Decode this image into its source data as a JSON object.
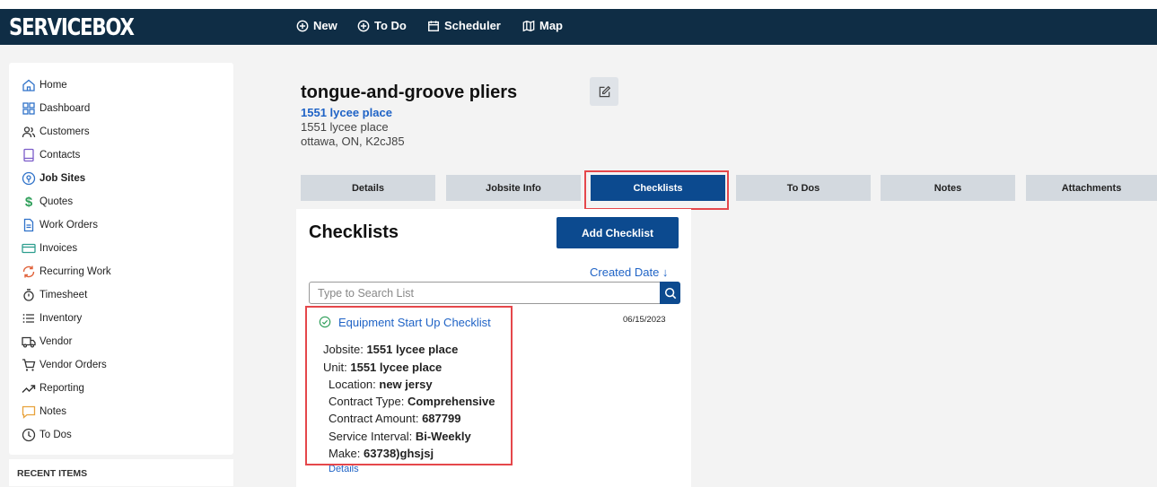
{
  "brand": "SERVICEBOX",
  "topnav": [
    {
      "label": "New",
      "icon": "plus-circle-icon"
    },
    {
      "label": "To Do",
      "icon": "plus-circle-icon"
    },
    {
      "label": "Scheduler",
      "icon": "calendar-icon"
    },
    {
      "label": "Map",
      "icon": "map-icon"
    }
  ],
  "sidebar": {
    "items": [
      {
        "label": "Home",
        "icon": "home-icon"
      },
      {
        "label": "Dashboard",
        "icon": "grid-icon"
      },
      {
        "label": "Customers",
        "icon": "users-icon"
      },
      {
        "label": "Contacts",
        "icon": "book-icon"
      },
      {
        "label": "Job Sites",
        "icon": "location-pin-icon"
      },
      {
        "label": "Quotes",
        "icon": "dollar-icon"
      },
      {
        "label": "Work Orders",
        "icon": "document-icon"
      },
      {
        "label": "Invoices",
        "icon": "card-icon"
      },
      {
        "label": "Recurring Work",
        "icon": "refresh-icon"
      },
      {
        "label": "Timesheet",
        "icon": "stopwatch-icon"
      },
      {
        "label": "Inventory",
        "icon": "list-icon"
      },
      {
        "label": "Vendor",
        "icon": "truck-icon"
      },
      {
        "label": "Vendor Orders",
        "icon": "cart-icon"
      },
      {
        "label": "Reporting",
        "icon": "trend-icon"
      },
      {
        "label": "Notes",
        "icon": "chat-icon"
      },
      {
        "label": "To Dos",
        "icon": "clock-icon"
      }
    ],
    "active": "Job Sites",
    "recent_title": "RECENT ITEMS"
  },
  "job": {
    "title": "tongue-and-groove pliers",
    "address_link": "1551 lycee place",
    "address_line1": "1551 lycee place",
    "address_line2": "ottawa, ON, K2cJ85"
  },
  "tabs": [
    "Details",
    "Jobsite Info",
    "Checklists",
    "To Dos",
    "Notes",
    "Attachments"
  ],
  "active_tab": "Checklists",
  "checklists": {
    "title": "Checklists",
    "add_label": "Add Checklist",
    "sort_label": "Created Date ↓",
    "search_placeholder": "Type to Search List",
    "item": {
      "name": "Equipment Start Up Checklist",
      "date": "06/15/2023",
      "fields": [
        {
          "label": "Jobsite:",
          "value": "1551 lycee place"
        },
        {
          "label": "Unit:",
          "value": "1551 lycee place"
        },
        {
          "label": "Location:",
          "value": "new jersy"
        },
        {
          "label": "Contract Type:",
          "value": "Comprehensive"
        },
        {
          "label": "Contract Amount:",
          "value": "687799"
        },
        {
          "label": "Service Interval:",
          "value": "Bi-Weekly"
        },
        {
          "label": "Make:",
          "value": "63738)ghsjsj"
        }
      ],
      "details_label": "Details"
    }
  },
  "colors": {
    "topbar": "#0f2d45",
    "primary": "#0c4a8f",
    "link": "#1f63c6",
    "highlight": "#e5474b"
  }
}
